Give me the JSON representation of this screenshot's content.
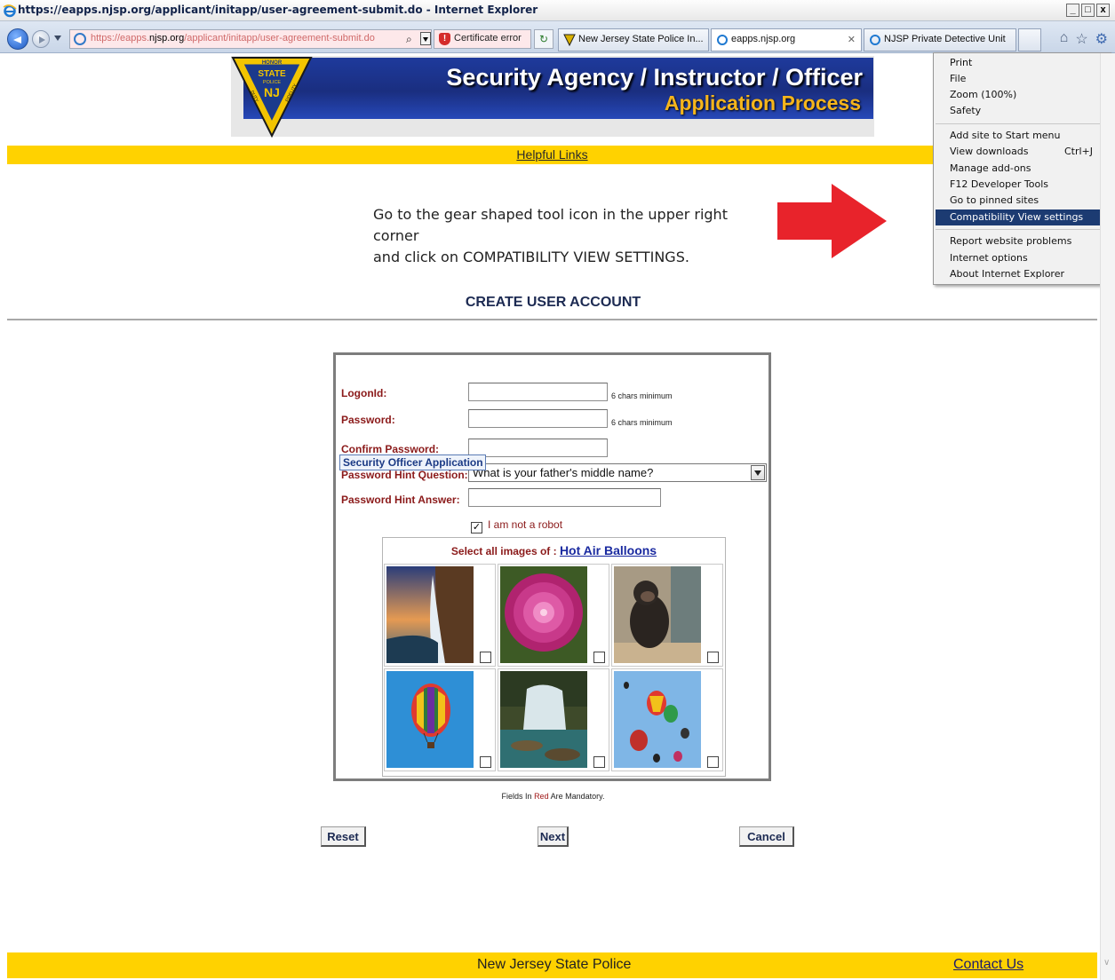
{
  "window": {
    "title": "https://eapps.njsp.org/applicant/initapp/user-agreement-submit.do - Internet Explorer",
    "controls": [
      "_",
      "□",
      "x"
    ]
  },
  "address_bar": {
    "url_prefix": "https://eapps.",
    "url_domain": "njsp.org",
    "url_path": "/applicant/initapp/user-agreement-submit.do",
    "cert_error": "Certificate error"
  },
  "tabs": [
    {
      "label": "New Jersey State Police In..."
    },
    {
      "label": "eapps.njsp.org"
    },
    {
      "label": "NJSP Private Detective Unit"
    }
  ],
  "banner": {
    "title": "Security Agency / Instructor / Officer",
    "subtitle": "Application Process",
    "badge_top": "HONOR",
    "badge_mid1": "STATE",
    "badge_mid2": "POLICE",
    "badge_nj": "NJ",
    "badge_left": "DUTY",
    "badge_right": "FIDELITY"
  },
  "links": {
    "helpful": "Helpful Links"
  },
  "instruction": {
    "line1": "Go to the gear shaped tool icon in the upper right corner",
    "line2": "and click on COMPATIBILITY VIEW SETTINGS."
  },
  "menu": {
    "items": [
      {
        "label": "Print",
        "submenu": true
      },
      {
        "label": "File",
        "submenu": true
      },
      {
        "label": "Zoom (100%)",
        "submenu": true
      },
      {
        "label": "Safety",
        "submenu": true
      },
      {
        "label": "Add site to Start menu"
      },
      {
        "label": "View downloads",
        "shortcut": "Ctrl+J"
      },
      {
        "label": "Manage add-ons"
      },
      {
        "label": "F12 Developer Tools"
      },
      {
        "label": "Go to pinned sites"
      },
      {
        "label": "Compatibility View settings",
        "highlighted": true
      },
      {
        "label": "Report website problems"
      },
      {
        "label": "Internet options"
      },
      {
        "label": "About Internet Explorer"
      }
    ]
  },
  "section_title": "CREATE USER ACCOUNT",
  "form": {
    "logon_label": "LogonId:",
    "logon_value": "",
    "logon_hint": "6 chars minimum",
    "password_label": "Password:",
    "password_value": "",
    "password_hint": "6 chars minimum",
    "confirm_label": "Confirm Password:",
    "confirm_value": "",
    "hint_question_label": "Password Hint Question:",
    "hint_question_value": "What is your father's middle name?",
    "hint_answer_label": "Password Hint Answer:",
    "hint_answer_value": "",
    "tooltip": "Security Officer Application",
    "robot_label": "I am not a robot",
    "robot_checked": true
  },
  "captcha": {
    "prompt": "Select all images of : ",
    "target": "Hot Air Balloons",
    "images": [
      {
        "name": "waterfall-sunset"
      },
      {
        "name": "pink-dahlia"
      },
      {
        "name": "chimpanzee"
      },
      {
        "name": "hot-air-balloon"
      },
      {
        "name": "waterfall-rocks"
      },
      {
        "name": "hot-air-balloons-sky"
      }
    ]
  },
  "mandatory_note": {
    "before": "Fields In ",
    "red": "Red",
    "after": " Are Mandatory."
  },
  "buttons": {
    "reset": "Reset",
    "next": "Next",
    "cancel": "Cancel"
  },
  "footer": {
    "org": "New Jersey State Police",
    "contact": "Contact Us"
  },
  "colors": {
    "yellow_bar": "#ffd200",
    "banner_blue": "#1e3a9c",
    "label_red": "#8b1a1a",
    "arrow_red": "#e8232b",
    "menu_highlight": "#1c3b72"
  }
}
